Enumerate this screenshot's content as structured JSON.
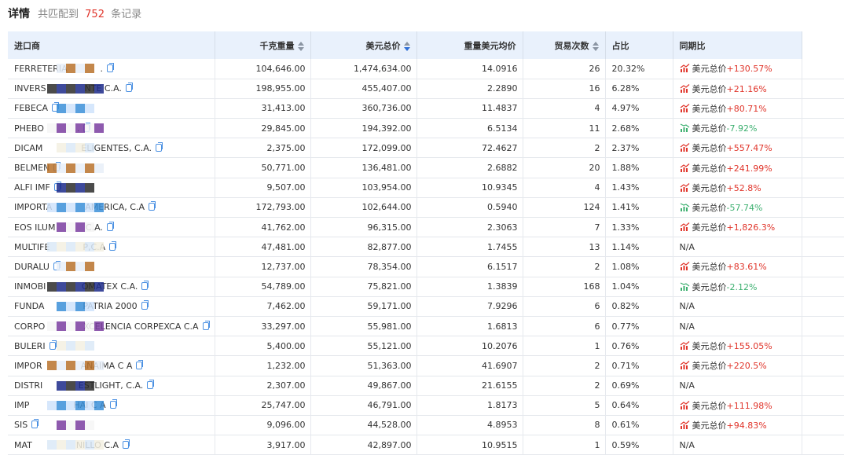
{
  "header": {
    "title": "详情",
    "summary_prefix": "共匹配到",
    "count": "752",
    "summary_suffix": "条记录"
  },
  "colors": {
    "up": "#e0342a",
    "down": "#3db070",
    "accent": "#2f6fd6",
    "header_bg": "#e9f1fc"
  },
  "columns": [
    {
      "label": "进口商",
      "sortable": false
    },
    {
      "label": "千克重量",
      "sortable": true
    },
    {
      "label": "美元总价",
      "sortable": true,
      "active": true
    },
    {
      "label": "重量美元均价",
      "sortable": false
    },
    {
      "label": "贸易次数",
      "sortable": true
    },
    {
      "label": "占比",
      "sortable": false
    },
    {
      "label": "同期比",
      "sortable": false
    }
  ],
  "rows": [
    {
      "name": "FERRETERIA            .",
      "weight": "104,646.00",
      "usd": "1,474,634.00",
      "avg": "14.0916",
      "trades": "26",
      "share": "20.32%",
      "yoy_label": "美元总价",
      "yoy": "+130.57%",
      "trend": "up"
    },
    {
      "name": "INVERS              NTE C.A.",
      "weight": "198,955.00",
      "usd": "455,407.00",
      "avg": "2.2890",
      "trades": "16",
      "share": "6.28%",
      "yoy_label": "美元总价",
      "yoy": "+21.16%",
      "trend": "up"
    },
    {
      "name": "FEBECA",
      "weight": "31,413.00",
      "usd": "360,736.00",
      "avg": "11.4837",
      "trades": "4",
      "share": "4.97%",
      "yoy_label": "美元总价",
      "yoy": "+80.71%",
      "trend": "up"
    },
    {
      "name": "PHEBO            .",
      "weight": "29,845.00",
      "usd": "194,392.00",
      "avg": "6.5134",
      "trades": "11",
      "share": "2.68%",
      "yoy_label": "美元总价",
      "yoy": "-7.92%",
      "trend": "down"
    },
    {
      "name": "DICAM              ELIGENTES, C.A.",
      "weight": "2,375.00",
      "usd": "172,099.00",
      "avg": "72.4627",
      "trades": "2",
      "share": "2.37%",
      "yoy_label": "美元总价",
      "yoy": "+557.47%",
      "trend": "up"
    },
    {
      "name": "BELMEN",
      "weight": "50,771.00",
      "usd": "136,481.00",
      "avg": "2.6882",
      "trades": "20",
      "share": "1.88%",
      "yoy_label": "美元总价",
      "yoy": "+241.99%",
      "trend": "up"
    },
    {
      "name": "ALFI IMF",
      "weight": "9,507.00",
      "usd": "103,954.00",
      "avg": "10.9345",
      "trades": "4",
      "share": "1.43%",
      "yoy_label": "美元总价",
      "yoy": "+52.8%",
      "trend": "up"
    },
    {
      "name": "IMPORTA            AMERICA, C.A",
      "weight": "172,793.00",
      "usd": "102,644.00",
      "avg": "0.5940",
      "trades": "124",
      "share": "1.41%",
      "yoy_label": "美元总价",
      "yoy": "-57.74%",
      "trend": "down"
    },
    {
      "name": "EOS ILUM           C.A.",
      "weight": "41,762.00",
      "usd": "96,315.00",
      "avg": "2.3063",
      "trades": "7",
      "share": "1.33%",
      "yoy_label": "美元总价",
      "yoy": "+1,826.3%",
      "trend": "up"
    },
    {
      "name": "MULTIFE            P,C.A",
      "weight": "47,481.00",
      "usd": "82,877.00",
      "avg": "1.7455",
      "trades": "13",
      "share": "1.14%",
      "yoy_label": "",
      "yoy": "N/A",
      "trend": "none"
    },
    {
      "name": "DURALU",
      "weight": "12,737.00",
      "usd": "78,354.00",
      "avg": "6.1517",
      "trades": "2",
      "share": "1.08%",
      "yoy_label": "美元总价",
      "yoy": "+83.61%",
      "trend": "up"
    },
    {
      "name": "INMOBI             OMATEX C.A.",
      "weight": "54,789.00",
      "usd": "75,821.00",
      "avg": "1.3839",
      "trades": "168",
      "share": "1.04%",
      "yoy_label": "美元总价",
      "yoy": "-2.12%",
      "trend": "down"
    },
    {
      "name": "FUNDA              PATRIA 2000",
      "weight": "7,462.00",
      "usd": "59,171.00",
      "avg": "7.9296",
      "trades": "6",
      "share": "0.82%",
      "yoy_label": "",
      "yoy": "N/A",
      "trend": "none"
    },
    {
      "name": "CORPO              XCELENCIA CORPEXCA C.A",
      "weight": "33,297.00",
      "usd": "55,981.00",
      "avg": "1.6813",
      "trades": "6",
      "share": "0.77%",
      "yoy_label": "",
      "yoy": "N/A",
      "trend": "none"
    },
    {
      "name": "BULERI",
      "weight": "5,400.00",
      "usd": "55,121.00",
      "avg": "10.2076",
      "trades": "1",
      "share": "0.76%",
      "yoy_label": "美元总价",
      "yoy": "+155.05%",
      "trend": "up"
    },
    {
      "name": "IMPOR              ANAIMA C A",
      "weight": "1,232.00",
      "usd": "51,363.00",
      "avg": "41.6907",
      "trades": "2",
      "share": "0.71%",
      "yoy_label": "美元总价",
      "yoy": "+220.5%",
      "trend": "up"
    },
    {
      "name": "DISTRI             ESTLIGHT, C.A.",
      "weight": "2,307.00",
      "usd": "49,867.00",
      "avg": "21.6155",
      "trades": "2",
      "share": "0.69%",
      "yoy_label": "",
      "yoy": "N/A",
      "trend": "none"
    },
    {
      "name": "IMP                HAI C A",
      "weight": "25,747.00",
      "usd": "46,791.00",
      "avg": "1.8173",
      "trades": "5",
      "share": "0.64%",
      "yoy_label": "美元总价",
      "yoy": "+111.98%",
      "trend": "up"
    },
    {
      "name": "SIS",
      "weight": "9,096.00",
      "usd": "44,528.00",
      "avg": "4.8953",
      "trades": "8",
      "share": "0.61%",
      "yoy_label": "美元总价",
      "yoy": "+94.83%",
      "trend": "up"
    },
    {
      "name": "MAT                NILLO C.A",
      "weight": "3,917.00",
      "usd": "42,897.00",
      "avg": "10.9515",
      "trades": "1",
      "share": "0.59%",
      "yoy_label": "",
      "yoy": "N/A",
      "trend": "none"
    }
  ]
}
